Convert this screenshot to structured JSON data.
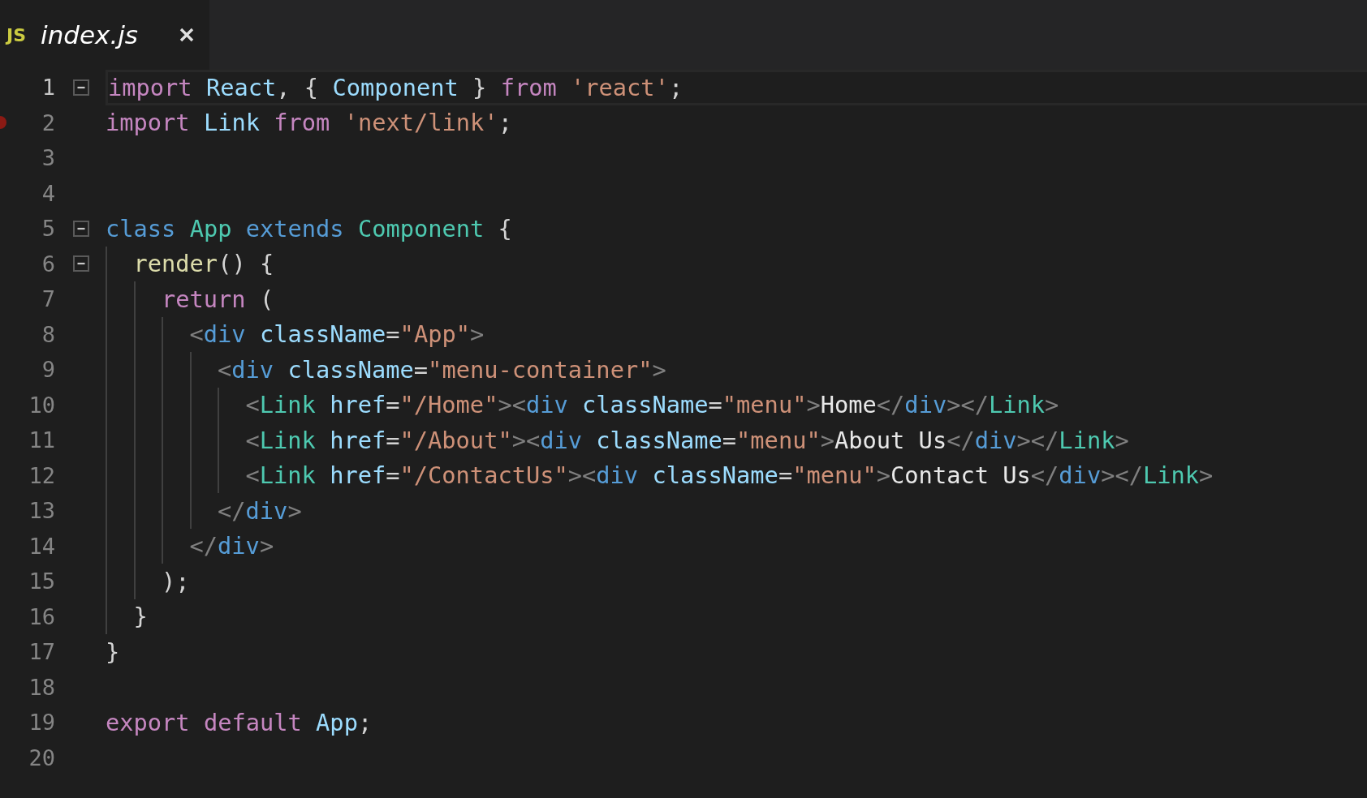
{
  "tab": {
    "icon_text": "JS",
    "title": "index.js"
  },
  "lines": [
    {
      "number": "1",
      "current": true,
      "foldable": true,
      "tokens": [
        {
          "kind": "keyword",
          "text": "import"
        },
        {
          "kind": "variable",
          "text": " React"
        },
        {
          "kind": "plain",
          "text": ", { "
        },
        {
          "kind": "variable",
          "text": "Component"
        },
        {
          "kind": "plain",
          "text": " }"
        },
        {
          "kind": "keyword",
          "text": " from"
        },
        {
          "kind": "string",
          "text": " 'react'"
        },
        {
          "kind": "plain",
          "text": ";"
        }
      ]
    },
    {
      "number": "2",
      "current": false,
      "breakpoint": true,
      "tokens": [
        {
          "kind": "keyword",
          "text": "import"
        },
        {
          "kind": "variable",
          "text": " Link"
        },
        {
          "kind": "keyword",
          "text": " from"
        },
        {
          "kind": "string",
          "text": " 'next/link'"
        },
        {
          "kind": "plain",
          "text": ";"
        }
      ]
    },
    {
      "number": "3",
      "current": false
    },
    {
      "number": "4",
      "current": false
    },
    {
      "number": "5",
      "current": false,
      "foldable": true,
      "tokens": [
        {
          "kind": "storage",
          "text": "class"
        },
        {
          "kind": "type",
          "text": " App"
        },
        {
          "kind": "storage",
          "text": " extends"
        },
        {
          "kind": "type",
          "text": " Component"
        },
        {
          "kind": "plain",
          "text": " {"
        }
      ],
      "children": [
        {
          "number": "6",
          "current": false,
          "foldable": true,
          "tokens": [
            {
              "kind": "function",
              "text": "render"
            },
            {
              "kind": "plain",
              "text": "() {"
            }
          ],
          "children": [
            {
              "number": "7",
              "current": false,
              "tokens": [
                {
                  "kind": "keyword",
                  "text": "return"
                },
                {
                  "kind": "plain",
                  "text": " ("
                }
              ],
              "children": [
                {
                  "number": "8",
                  "current": false,
                  "tokens": [
                    {
                      "kind": "punct",
                      "text": "<"
                    },
                    {
                      "kind": "tag",
                      "text": "div"
                    },
                    {
                      "kind": "attr",
                      "text": " className"
                    },
                    {
                      "kind": "plain",
                      "text": "="
                    },
                    {
                      "kind": "string",
                      "text": "\"App\""
                    },
                    {
                      "kind": "punct",
                      "text": ">"
                    }
                  ],
                  "children": [
                    {
                      "number": "9",
                      "current": false,
                      "tokens": [
                        {
                          "kind": "punct",
                          "text": "<"
                        },
                        {
                          "kind": "tag",
                          "text": "div"
                        },
                        {
                          "kind": "attr",
                          "text": " className"
                        },
                        {
                          "kind": "plain",
                          "text": "="
                        },
                        {
                          "kind": "string",
                          "text": "\"menu-container\""
                        },
                        {
                          "kind": "punct",
                          "text": ">"
                        }
                      ],
                      "children": [
                        {
                          "number": "10",
                          "current": false,
                          "tokens": [
                            {
                              "kind": "punct",
                              "text": "<"
                            },
                            {
                              "kind": "type",
                              "text": "Link"
                            },
                            {
                              "kind": "attr",
                              "text": " href"
                            },
                            {
                              "kind": "plain",
                              "text": "="
                            },
                            {
                              "kind": "string",
                              "text": "\"/Home\""
                            },
                            {
                              "kind": "punct",
                              "text": "><"
                            },
                            {
                              "kind": "tag",
                              "text": "div"
                            },
                            {
                              "kind": "attr",
                              "text": " className"
                            },
                            {
                              "kind": "plain",
                              "text": "="
                            },
                            {
                              "kind": "string",
                              "text": "\"menu\""
                            },
                            {
                              "kind": "punct",
                              "text": ">"
                            },
                            {
                              "kind": "text",
                              "text": "Home"
                            },
                            {
                              "kind": "punct",
                              "text": "</"
                            },
                            {
                              "kind": "tag",
                              "text": "div"
                            },
                            {
                              "kind": "punct",
                              "text": "></"
                            },
                            {
                              "kind": "type",
                              "text": "Link"
                            },
                            {
                              "kind": "punct",
                              "text": ">"
                            }
                          ]
                        },
                        {
                          "number": "11",
                          "current": false,
                          "tokens": [
                            {
                              "kind": "punct",
                              "text": "<"
                            },
                            {
                              "kind": "type",
                              "text": "Link"
                            },
                            {
                              "kind": "attr",
                              "text": " href"
                            },
                            {
                              "kind": "plain",
                              "text": "="
                            },
                            {
                              "kind": "string",
                              "text": "\"/About\""
                            },
                            {
                              "kind": "punct",
                              "text": "><"
                            },
                            {
                              "kind": "tag",
                              "text": "div"
                            },
                            {
                              "kind": "attr",
                              "text": " className"
                            },
                            {
                              "kind": "plain",
                              "text": "="
                            },
                            {
                              "kind": "string",
                              "text": "\"menu\""
                            },
                            {
                              "kind": "punct",
                              "text": ">"
                            },
                            {
                              "kind": "text",
                              "text": "About Us"
                            },
                            {
                              "kind": "punct",
                              "text": "</"
                            },
                            {
                              "kind": "tag",
                              "text": "div"
                            },
                            {
                              "kind": "punct",
                              "text": "></"
                            },
                            {
                              "kind": "type",
                              "text": "Link"
                            },
                            {
                              "kind": "punct",
                              "text": ">"
                            }
                          ]
                        },
                        {
                          "number": "12",
                          "current": false,
                          "tokens": [
                            {
                              "kind": "punct",
                              "text": "<"
                            },
                            {
                              "kind": "type",
                              "text": "Link"
                            },
                            {
                              "kind": "attr",
                              "text": " href"
                            },
                            {
                              "kind": "plain",
                              "text": "="
                            },
                            {
                              "kind": "string",
                              "text": "\"/ContactUs\""
                            },
                            {
                              "kind": "punct",
                              "text": "><"
                            },
                            {
                              "kind": "tag",
                              "text": "div"
                            },
                            {
                              "kind": "attr",
                              "text": " className"
                            },
                            {
                              "kind": "plain",
                              "text": "="
                            },
                            {
                              "kind": "string",
                              "text": "\"menu\""
                            },
                            {
                              "kind": "punct",
                              "text": ">"
                            },
                            {
                              "kind": "text",
                              "text": "Contact Us"
                            },
                            {
                              "kind": "punct",
                              "text": "</"
                            },
                            {
                              "kind": "tag",
                              "text": "div"
                            },
                            {
                              "kind": "punct",
                              "text": "></"
                            },
                            {
                              "kind": "type",
                              "text": "Link"
                            },
                            {
                              "kind": "punct",
                              "text": ">"
                            }
                          ]
                        }
                      ]
                    },
                    {
                      "number": "13",
                      "current": false,
                      "tokens": [
                        {
                          "kind": "punct",
                          "text": "</"
                        },
                        {
                          "kind": "tag",
                          "text": "div"
                        },
                        {
                          "kind": "punct",
                          "text": ">"
                        }
                      ]
                    }
                  ]
                },
                {
                  "number": "14",
                  "current": false,
                  "tokens": [
                    {
                      "kind": "punct",
                      "text": "</"
                    },
                    {
                      "kind": "tag",
                      "text": "div"
                    },
                    {
                      "kind": "punct",
                      "text": ">"
                    }
                  ]
                }
              ]
            },
            {
              "number": "15",
              "current": false,
              "tokens": [
                {
                  "kind": "plain",
                  "text": ");"
                }
              ]
            }
          ]
        },
        {
          "number": "16",
          "current": false,
          "tokens": [
            {
              "kind": "plain",
              "text": "}"
            }
          ]
        }
      ]
    },
    {
      "number": "17",
      "current": false,
      "tokens": [
        {
          "kind": "plain",
          "text": "}"
        }
      ]
    },
    {
      "number": "18",
      "current": false
    },
    {
      "number": "19",
      "current": false,
      "tokens": [
        {
          "kind": "keyword",
          "text": "export"
        },
        {
          "kind": "keyword",
          "text": " default"
        },
        {
          "kind": "variable",
          "text": " App"
        },
        {
          "kind": "plain",
          "text": ";"
        }
      ]
    },
    {
      "number": "20",
      "current": false
    }
  ]
}
